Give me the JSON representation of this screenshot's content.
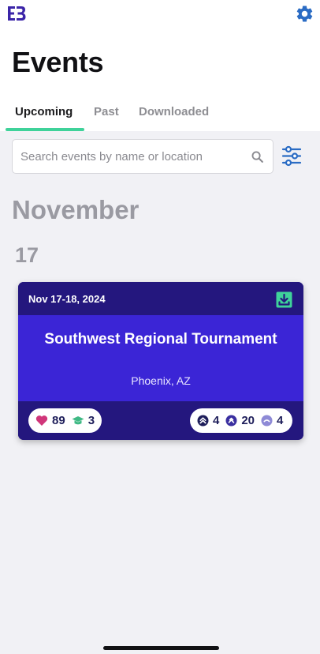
{
  "header": {
    "logo_icon": "eb-logo-icon",
    "settings_icon": "gear-icon",
    "title": "Events",
    "accent_color": "#3fd29a",
    "brand_color": "#2b6cc4"
  },
  "tabs": [
    {
      "label": "Upcoming",
      "active": true
    },
    {
      "label": "Past",
      "active": false
    },
    {
      "label": "Downloaded",
      "active": false
    }
  ],
  "search": {
    "placeholder": "Search events by name or location",
    "value": "",
    "icon": "search-icon",
    "filter_icon": "sliders-icon"
  },
  "groups": [
    {
      "month": "November",
      "day": "17",
      "events": [
        {
          "dates": "Nov 17-18, 2024",
          "title": "Southwest Regional Tournament",
          "location": "Phoenix, AZ",
          "download_icon": "download-icon",
          "stats": {
            "likes": "89",
            "graduates": "3",
            "level_a": "4",
            "level_b": "20",
            "level_c": "4"
          }
        }
      ]
    }
  ]
}
